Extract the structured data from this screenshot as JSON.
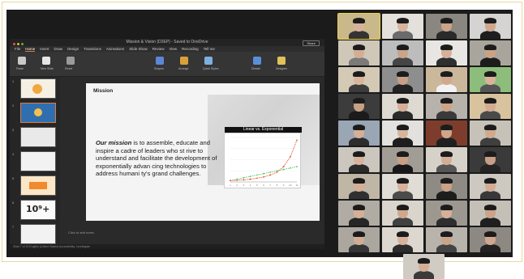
{
  "app": {
    "title": "Mission & Vision (D2EP) - Saved to OneDrive",
    "share_label": "Share",
    "menu": [
      "File",
      "Home",
      "Insert",
      "Draw",
      "Design",
      "Transitions",
      "Animations",
      "Slide Show",
      "Review",
      "View",
      "Recording",
      "Tell me"
    ],
    "ribbon_labels": [
      "Paste",
      "New Slide",
      "Reset",
      "Shapes",
      "Arrange",
      "Quick Styles",
      "Dictate",
      "Designer"
    ],
    "slide_numbers": [
      "1",
      "2",
      "3",
      "4",
      "5",
      "6",
      "7"
    ],
    "thumb_big_text": "10⁹+",
    "notes_placeholder": "Click to add notes",
    "status_text": "Slide 7 of 20   English (United States)   Accessibility: Investigate"
  },
  "slide": {
    "title": "Mission",
    "mission_lead": "Our mission",
    "mission_text": " is to assemble, educate and inspire a cadre of leaders who st rive to understand and facilitate the development of exponentially advan cing technologies to address humani ty's grand challenges."
  },
  "chart_data": {
    "type": "line",
    "title": "Linear vs. Exponential",
    "categories": [
      "1",
      "2",
      "3",
      "4",
      "5",
      "6",
      "7",
      "8",
      "9",
      "10",
      "11"
    ],
    "series": [
      {
        "values": [
          1,
          2,
          3,
          4,
          5,
          6,
          7,
          8,
          9,
          10,
          11
        ],
        "color": "#5cc46d"
      },
      {
        "values": [
          1,
          1.2,
          1.5,
          2,
          2.7,
          3.6,
          5,
          7,
          11,
          18,
          30
        ],
        "color": "#e2552f"
      }
    ],
    "ylim": [
      0,
      32
    ]
  },
  "gallery": {
    "tiles": [
      {
        "bg": "#c9b88a",
        "skin": "#d7b29a",
        "shirt": "#333333"
      },
      {
        "bg": "#e4e1dc",
        "skin": "#d9b49c",
        "shirt": "#6b6b6b"
      },
      {
        "bg": "#8a8680",
        "skin": "#c9a489",
        "shirt": "#2a2a2a"
      },
      {
        "bg": "#d5d4d2",
        "skin": "#cfa58c",
        "shirt": "#1e1e1e"
      },
      {
        "bg": "#cfc7b8",
        "skin": "#d4ae94",
        "shirt": "#7a7a7a"
      },
      {
        "bg": "#bdbdbd",
        "skin": "#c9a38a",
        "shirt": "#454545"
      },
      {
        "bg": "#e8e6e2",
        "skin": "#d6b099",
        "shirt": "#2f2f2f"
      },
      {
        "bg": "#a9a59c",
        "skin": "#caa286",
        "shirt": "#1c1c1c"
      },
      {
        "bg": "#d3c9b5",
        "skin": "#d9b59c",
        "shirt": "#3c3c3c"
      },
      {
        "bg": "#8e8e8e",
        "skin": "#c79f86",
        "shirt": "#222222"
      },
      {
        "bg": "#cbb79a",
        "skin": "#d1a88e",
        "shirt": "#f2f2f2"
      },
      {
        "bg": "#8dbd7a",
        "skin": "#d8b49a",
        "shirt": "#555555"
      },
      {
        "bg": "#3c3c3c",
        "skin": "#c8a084",
        "shirt": "#1b1b1b"
      },
      {
        "bg": "#dedad2",
        "skin": "#d6af97",
        "shirt": "#2b2b2b"
      },
      {
        "bg": "#b7b3ac",
        "skin": "#cca588",
        "shirt": "#3a3a3a"
      },
      {
        "bg": "#d8c39e",
        "skin": "#d3ab91",
        "shirt": "#4a4a4a"
      },
      {
        "bg": "#9aa6b3",
        "skin": "#d5af96",
        "shirt": "#2d2d2d"
      },
      {
        "bg": "#e3e1dd",
        "skin": "#d9b49c",
        "shirt": "#1e1e1e"
      },
      {
        "bg": "#7e3d2c",
        "skin": "#cfa68c",
        "shirt": "#202020"
      },
      {
        "bg": "#c7c2b8",
        "skin": "#d0a98e",
        "shirt": "#3f3f3f"
      },
      {
        "bg": "#cbc7bf",
        "skin": "#d8b39b",
        "shirt": "#2a2a2a"
      },
      {
        "bg": "#a19d95",
        "skin": "#c9a085",
        "shirt": "#181818"
      },
      {
        "bg": "#d6d2ca",
        "skin": "#d3ad94",
        "shirt": "#555555"
      },
      {
        "bg": "#3a3a3a",
        "skin": "#c69f85",
        "shirt": "#242424"
      },
      {
        "bg": "#bfb6a6",
        "skin": "#d4ae95",
        "shirt": "#303030"
      },
      {
        "bg": "#e0ddd6",
        "skin": "#d7b199",
        "shirt": "#4b4b4b"
      },
      {
        "bg": "#8f8b84",
        "skin": "#c9a287",
        "shirt": "#1d1d1d"
      },
      {
        "bg": "#cdc9c1",
        "skin": "#d2ab92",
        "shirt": "#383838"
      },
      {
        "bg": "#b0aca4",
        "skin": "#d5b097",
        "shirt": "#262626"
      },
      {
        "bg": "#d9d5cd",
        "skin": "#cfa78d",
        "shirt": "#414141"
      },
      {
        "bg": "#9c9890",
        "skin": "#d6b098",
        "shirt": "#2e2e2e"
      },
      {
        "bg": "#c4c0b8",
        "skin": "#caa388",
        "shirt": "#1f1f1f"
      },
      {
        "bg": "#aba79f",
        "skin": "#d3ad93",
        "shirt": "#353535"
      },
      {
        "bg": "#dcd8d0",
        "skin": "#d8b29a",
        "shirt": "#2c2c2c"
      },
      {
        "bg": "#b8b4ac",
        "skin": "#cca489",
        "shirt": "#444444"
      },
      {
        "bg": "#8d8982",
        "skin": "#d0a88f",
        "shirt": "#222222"
      },
      {
        "bg": "#d0ccc4",
        "skin": "#d4ae96",
        "shirt": "#3b3b3b"
      }
    ]
  }
}
